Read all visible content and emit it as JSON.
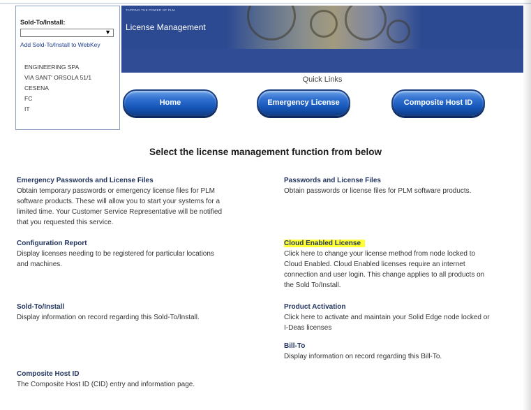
{
  "sold_to": {
    "label": "Sold-To/Install:",
    "selected": "",
    "link": "Add Sold-To/Install to WebKey",
    "address": [
      "ENGINEERING SPA",
      "VIA SANT' ORSOLA 51/1",
      "CESENA",
      "FC",
      "IT"
    ]
  },
  "banner": {
    "tagline": "TAPPING THE POWER OF PLM",
    "title": "License Management"
  },
  "quick_links": {
    "label": "Quick Links",
    "buttons": [
      "Home",
      "Emergency License",
      "Composite Host ID"
    ]
  },
  "heading": "Select the license management function from below",
  "functions": {
    "emergency": {
      "title": "Emergency Passwords and License Files",
      "lines": [
        "Obtain temporary passwords or emergency license files for PLM",
        "software products. These will allow you to start your systems for a",
        "limited time. Your Customer Service Representative will be notified",
        "that you requested this service."
      ]
    },
    "passwords": {
      "title": "Passwords and License Files",
      "lines": [
        "Obtain passwords or license files for PLM software products."
      ]
    },
    "config": {
      "title": "Configuration Report",
      "lines": [
        "Display licenses needing to be registered for particular locations",
        "and machines."
      ]
    },
    "cloud": {
      "title": "Cloud Enabled License",
      "lines": [
        "Click here to change your license method from node locked to",
        "Cloud Enabled. Cloud Enabled licenses require an internet",
        "connection and user login. This change applies to all products on",
        "the Sold To/Install."
      ]
    },
    "soldto": {
      "title": "Sold-To/Install",
      "lines": [
        "Display information on record regarding this Sold-To/Install."
      ]
    },
    "activation": {
      "title": "Product Activation",
      "lines": [
        "Click here to activate and maintain your Solid Edge node locked or",
        "I-Deas licenses"
      ]
    },
    "billto": {
      "title": "Bill-To",
      "lines": [
        "Display information on record regarding this Bill-To."
      ]
    },
    "cid": {
      "title": "Composite Host ID",
      "lines": [
        "The Composite Host ID (CID) entry and information page."
      ]
    }
  },
  "colors": {
    "banner": "#2c4a92",
    "button": "#1656b8",
    "highlight": "#ffff33",
    "title_text": "#23355e"
  }
}
